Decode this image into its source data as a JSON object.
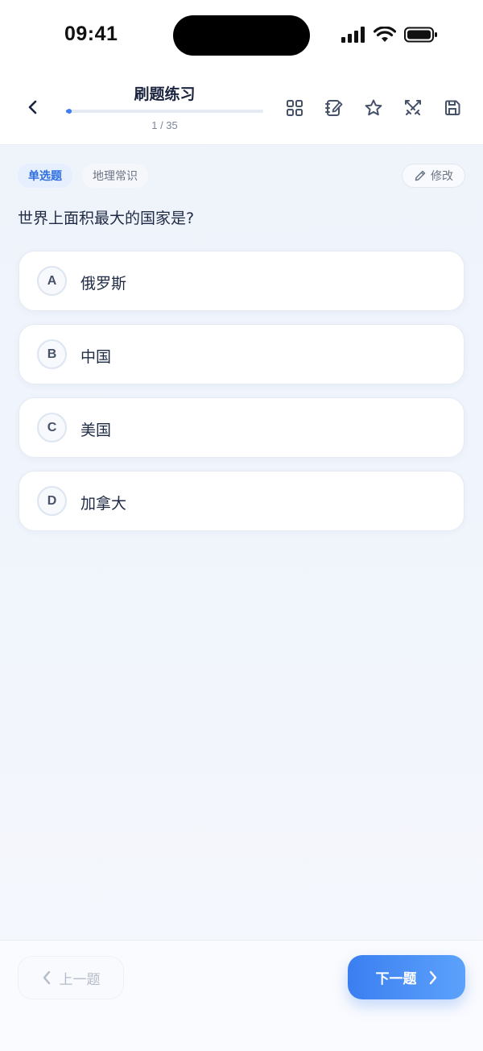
{
  "status_bar": {
    "time": "09:41"
  },
  "header": {
    "title": "刷题练习",
    "progress_text": "1 / 35",
    "progress_fraction": 0.03,
    "tools": [
      "grid-icon",
      "edit-note-icon",
      "star-icon",
      "sword-icon",
      "save-icon"
    ]
  },
  "question": {
    "type_tag": "单选题",
    "category_tag": "地理常识",
    "edit_label": "修改",
    "text": "世界上面积最大的国家是?",
    "options": [
      {
        "letter": "A",
        "text": "俄罗斯"
      },
      {
        "letter": "B",
        "text": "中国"
      },
      {
        "letter": "C",
        "text": "美国"
      },
      {
        "letter": "D",
        "text": "加拿大"
      }
    ]
  },
  "footer": {
    "prev_label": "上一题",
    "next_label": "下一题"
  },
  "colors": {
    "accent": "#3b7ef1",
    "text": "#1f2a44",
    "muted": "#7b8597"
  }
}
